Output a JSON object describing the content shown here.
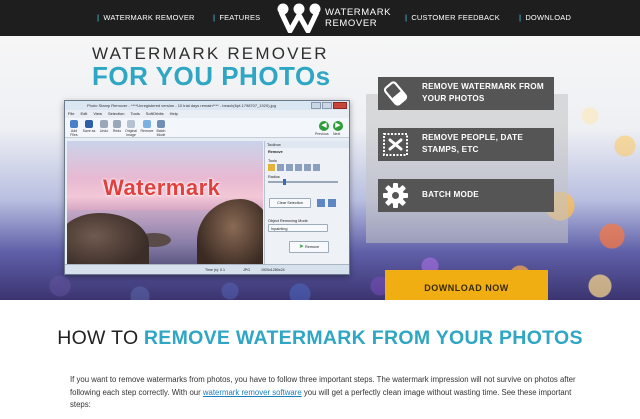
{
  "nav": {
    "links": [
      "FEATURES",
      "CUSTOMER FEEDBACK",
      "DOWNLOAD"
    ],
    "brand_link": "WATERMARK REMOVER",
    "logo_line1": "WATERMARK",
    "logo_line2": "REMOVER",
    "separator": "|"
  },
  "hero": {
    "title_line1": "WATERMARK REMOVER",
    "title_line2": "FOR YOU PHOTOs",
    "features": [
      {
        "icon": "eraser-icon",
        "text": "REMOVE WATERMARK FROM YOUR PHOTOS"
      },
      {
        "icon": "stamp-icon",
        "text": "REMOVE PEOPLE, DATE STAMPS, ETC"
      },
      {
        "icon": "gear-icon",
        "text": "BATCH MODE"
      }
    ],
    "download_label": "DOWNLOAD NOW"
  },
  "app_window": {
    "title": "Photo Stamp Remover - ****Unregistered version - 10 trial days remain**** - beach(6pf-1798707_1920).jpg",
    "menu": [
      "File",
      "Edit",
      "View",
      "Selection",
      "Tools",
      "SoftOrbits",
      "Help"
    ],
    "toolbar": [
      "Add Files",
      "Save as",
      "Undo",
      "Redo",
      "Original Image",
      "Remove",
      "Batch Mode"
    ],
    "nav_prev": "Previous",
    "nav_next": "Next",
    "photo_watermark": "Watermark",
    "panel": {
      "header": "Toolbox",
      "section": "Remove",
      "tools_label": "Tools",
      "radius_label": "Radius",
      "clear_selection": "Clear Selection",
      "object_mode_label": "Object Removing Mode",
      "object_mode_value": "Inpainting",
      "remove_button": "Remove"
    },
    "status": {
      "time": "Time (s): 0.1",
      "format": "JPG",
      "dims": "1920x1280x24"
    }
  },
  "howto": {
    "dark": "HOW TO",
    "blue": "REMOVE WATERMARK FROM YOUR PHOTOS"
  },
  "intro": {
    "part1": "If you want to remove watermarks from photos, you have to follow three important steps. The watermark impression will not survive on photos after following each step correctly. With our",
    "link": "watermark remover software",
    "part2": "you will get a perfectly clean image without wasting time. See these important steps:"
  },
  "colors": {
    "nav_bg": "#1e1e1e",
    "accent": "#2fa6c4",
    "feature_bg": "#555555",
    "download_bg": "#f0ae13",
    "watermark_red": "#e0413f"
  }
}
